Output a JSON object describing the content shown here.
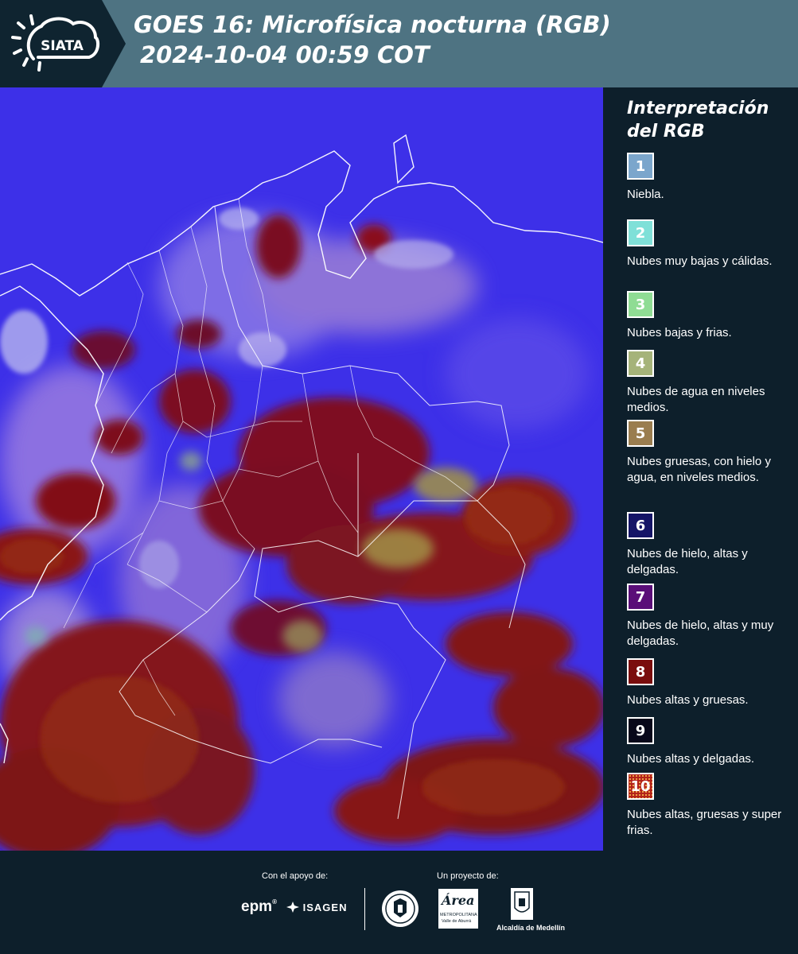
{
  "header": {
    "logo_text": "SIATA",
    "title_line1": "GOES 16: Microfísica nocturna (RGB)",
    "title_line2": "2024-10-04 00:59 COT"
  },
  "legend": {
    "title": "Interpretación del RGB",
    "items": [
      {
        "number": "1",
        "label": "Niebla.",
        "color": "#7ba6cc"
      },
      {
        "number": "2",
        "label": "Nubes muy bajas y cálidas.",
        "color": "#7fe0d8"
      },
      {
        "number": "3",
        "label": "Nubes bajas y frias.",
        "color": "#8fdc94"
      },
      {
        "number": "4",
        "label": "Nubes de agua en niveles medios.",
        "color": "#a5b37a"
      },
      {
        "number": "5",
        "label": "Nubes gruesas, con hielo y agua, en niveles medios.",
        "color": "#9a7d4f"
      },
      {
        "number": "6",
        "label": "Nubes de hielo, altas y delgadas.",
        "color": "#151567"
      },
      {
        "number": "7",
        "label": "Nubes de hielo, altas y muy delgadas.",
        "color": "#5a0e78"
      },
      {
        "number": "8",
        "label": "Nubes altas y gruesas.",
        "color": "#7a0d0d"
      },
      {
        "number": "9",
        "label": "Nubes altas y delgadas.",
        "color": "#08081a"
      },
      {
        "number": "10",
        "label": "Nubes altas, gruesas y super frias.",
        "color": "#b3221a"
      }
    ]
  },
  "footer": {
    "support_label": "Con el apoyo de:",
    "project_label": "Un proyecto de:",
    "sponsor_epm": "epm",
    "sponsor_epm_mark": "®",
    "sponsor_isagen": "ISAGEN",
    "area_logo_text": "Área",
    "area_name_line1": "METROPOLITANA",
    "area_name_line2": "Valle de Aburrá",
    "alcaldia": "Alcaldía de Medellín"
  }
}
